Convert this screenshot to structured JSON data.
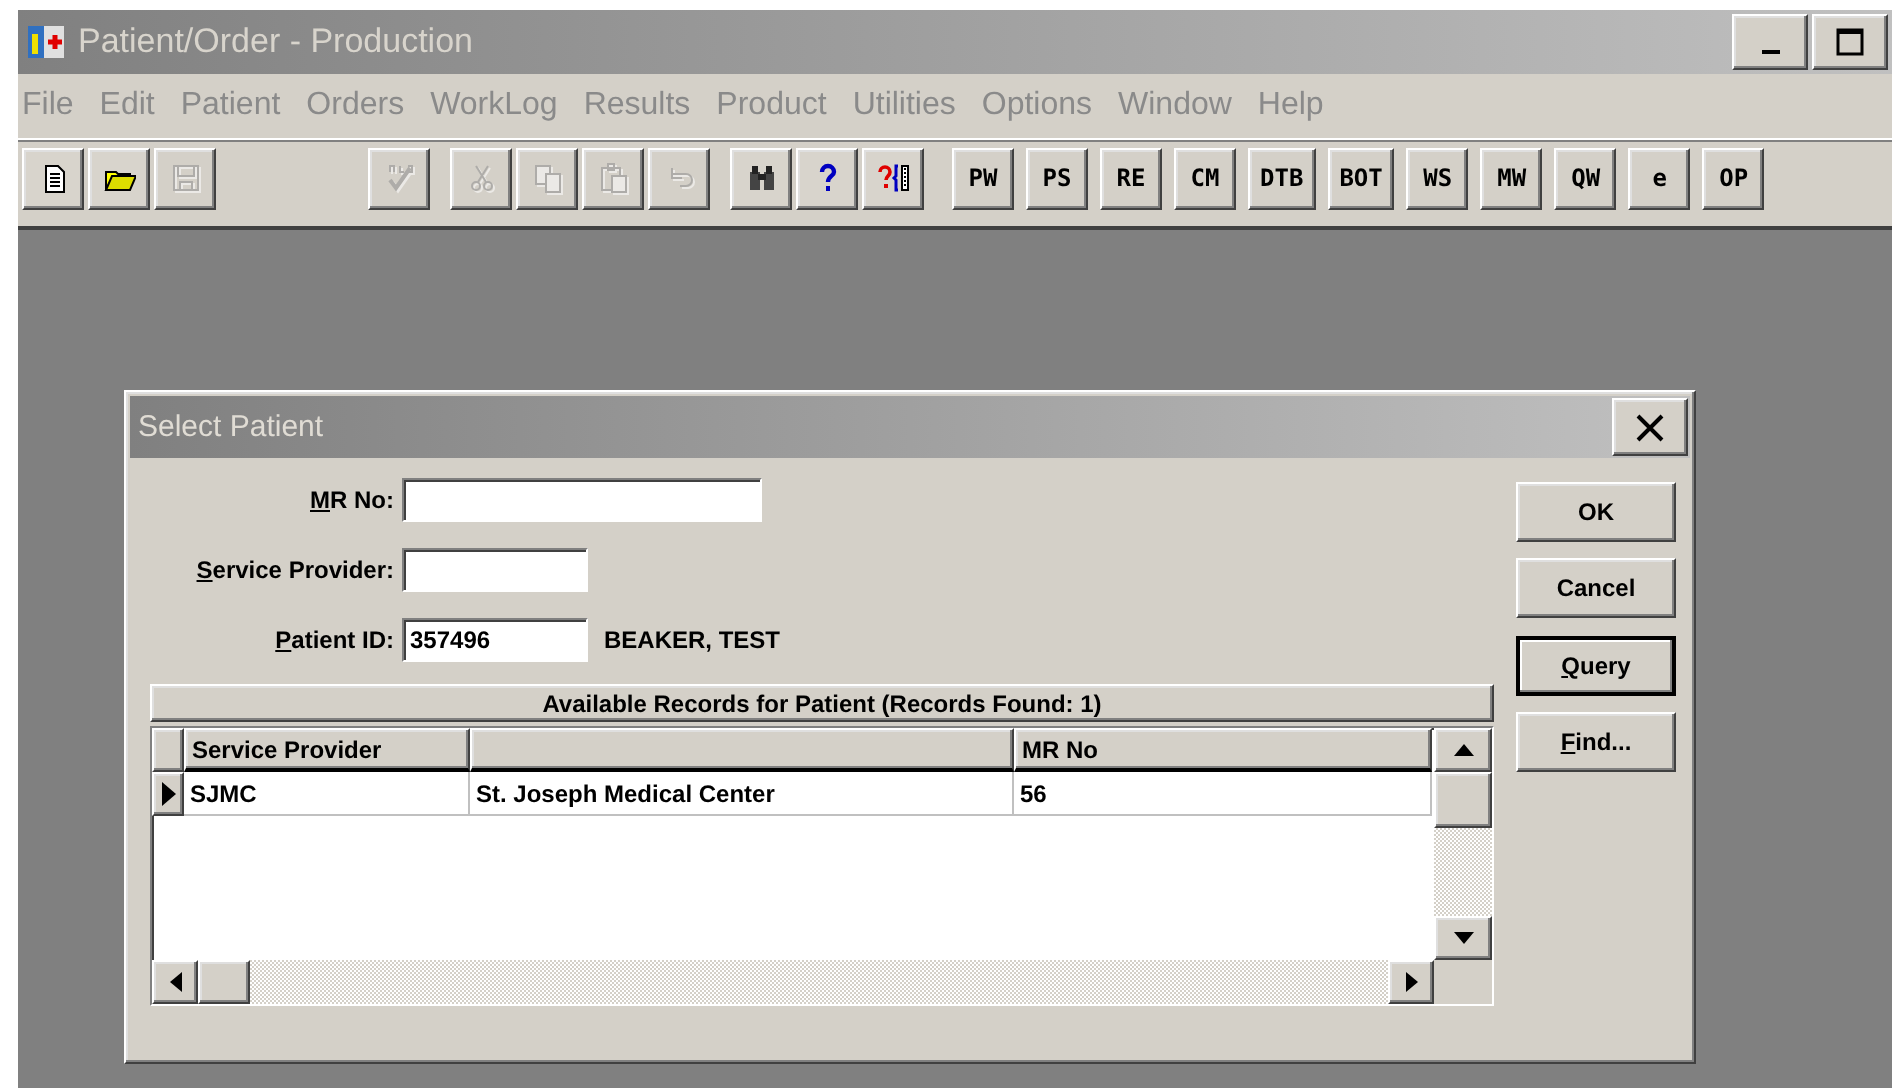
{
  "window": {
    "title": "Patient/Order - Production"
  },
  "menu": [
    "File",
    "Edit",
    "Patient",
    "Orders",
    "WorkLog",
    "Results",
    "Product",
    "Utilities",
    "Options",
    "Window",
    "Help"
  ],
  "toolbar": {
    "icon_groups": [
      [
        {
          "kind": "new",
          "disabled": false
        },
        {
          "kind": "open",
          "disabled": false
        },
        {
          "kind": "save",
          "disabled": true
        }
      ],
      [
        {
          "kind": "spell",
          "disabled": true
        }
      ],
      [
        {
          "kind": "cut",
          "disabled": true
        },
        {
          "kind": "copy",
          "disabled": true
        },
        {
          "kind": "paste",
          "disabled": true
        },
        {
          "kind": "undo",
          "disabled": true
        }
      ],
      [
        {
          "kind": "find",
          "disabled": false
        },
        {
          "kind": "help",
          "disabled": false
        },
        {
          "kind": "context",
          "disabled": false
        }
      ]
    ],
    "text_buttons": [
      "PW",
      "PS",
      "RE",
      "CM",
      "DTB",
      "BOT",
      "WS",
      "MW",
      "QW",
      "e",
      "OP"
    ]
  },
  "dialog": {
    "title": "Select Patient",
    "fields": [
      {
        "key": "M",
        "label": "R No:"
      },
      {
        "key": "S",
        "label": "ervice Provider:"
      },
      {
        "key": "P",
        "label": "atient ID:",
        "value": "357496",
        "note": "BEAKER, TEST"
      }
    ],
    "buttons": [
      {
        "label": "OK",
        "default": false
      },
      {
        "label": "Cancel",
        "default": false
      },
      {
        "key": "Q",
        "label": "uery",
        "default": true
      },
      {
        "key": "F",
        "label": "ind...",
        "default": false
      }
    ],
    "grid": {
      "caption": "Available Records for Patient (Records Found: 1)",
      "columns": [
        {
          "kind": "text",
          "label": "Service Provider"
        },
        {
          "kind": "blank"
        },
        {
          "kind": "text",
          "label": "MR No"
        }
      ],
      "rows": [
        {
          "selected": true,
          "cells": [
            "SJMC",
            "St. Joseph Medical Center",
            "56"
          ]
        }
      ]
    }
  }
}
